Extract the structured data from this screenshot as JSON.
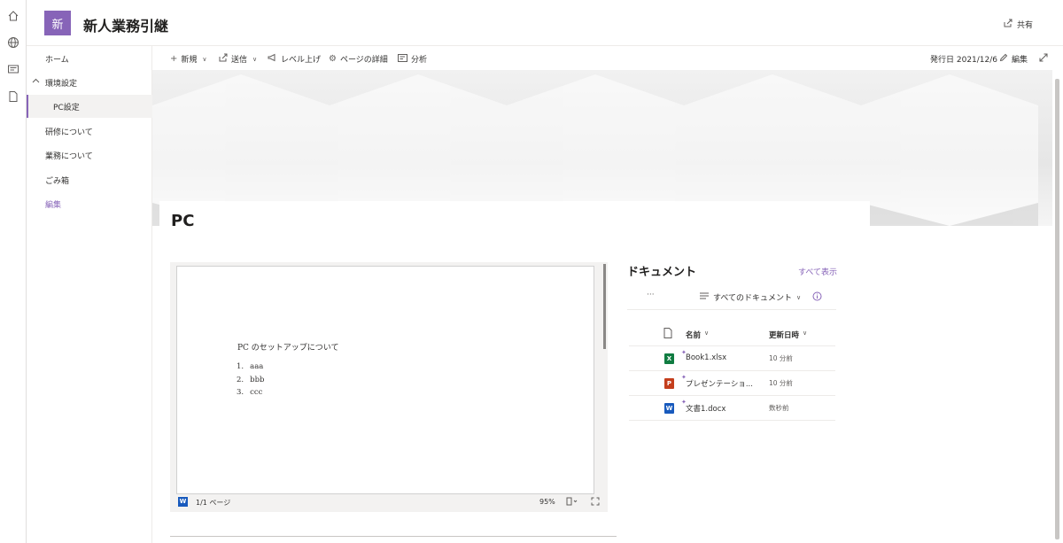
{
  "site": {
    "logo_text": "新",
    "title": "新人業務引継",
    "share_label": "共有"
  },
  "rail": {
    "icons": [
      "home-icon",
      "globe-icon",
      "news-icon",
      "page-icon"
    ]
  },
  "nav": {
    "items": [
      {
        "label": "ホーム"
      },
      {
        "label": "環境設定"
      },
      {
        "label": "PC設定"
      },
      {
        "label": "研修について"
      },
      {
        "label": "業務について"
      },
      {
        "label": "ごみ箱"
      },
      {
        "label": "編集"
      }
    ]
  },
  "commandbar": {
    "new_label": "新規",
    "send_label": "送信",
    "promote_label": "レベル上げ",
    "details_label": "ページの詳細",
    "analytics_label": "分析",
    "published_label": "発行日 2021/12/6",
    "edit_label": "編集"
  },
  "page": {
    "title": "PC"
  },
  "viewer": {
    "heading": "PC のセットアップについて",
    "list": [
      {
        "num": "1.",
        "text": "aaa"
      },
      {
        "num": "2.",
        "text": "bbb"
      },
      {
        "num": "3.",
        "text": "ccc"
      }
    ],
    "page_info": "1/1 ページ",
    "zoom": "95%"
  },
  "documents": {
    "title": "ドキュメント",
    "see_all": "すべて表示",
    "more": "···",
    "view_label": "すべてのドキュメント",
    "col_name": "名前",
    "col_modified": "更新日時",
    "files": [
      {
        "name": "Book1.xlsx",
        "modified": "10 分前",
        "type": "excel",
        "badge": "X",
        "color": "#107c41"
      },
      {
        "name": "プレゼンテーショ...",
        "modified": "10 分前",
        "type": "powerpoint",
        "badge": "P",
        "color": "#c43e1c"
      },
      {
        "name": "文書1.docx",
        "modified": "数秒前",
        "type": "word",
        "badge": "W",
        "color": "#185abd"
      }
    ]
  },
  "colors": {
    "accent": "#8764b8",
    "text": "#323130",
    "border": "#edebe9"
  }
}
